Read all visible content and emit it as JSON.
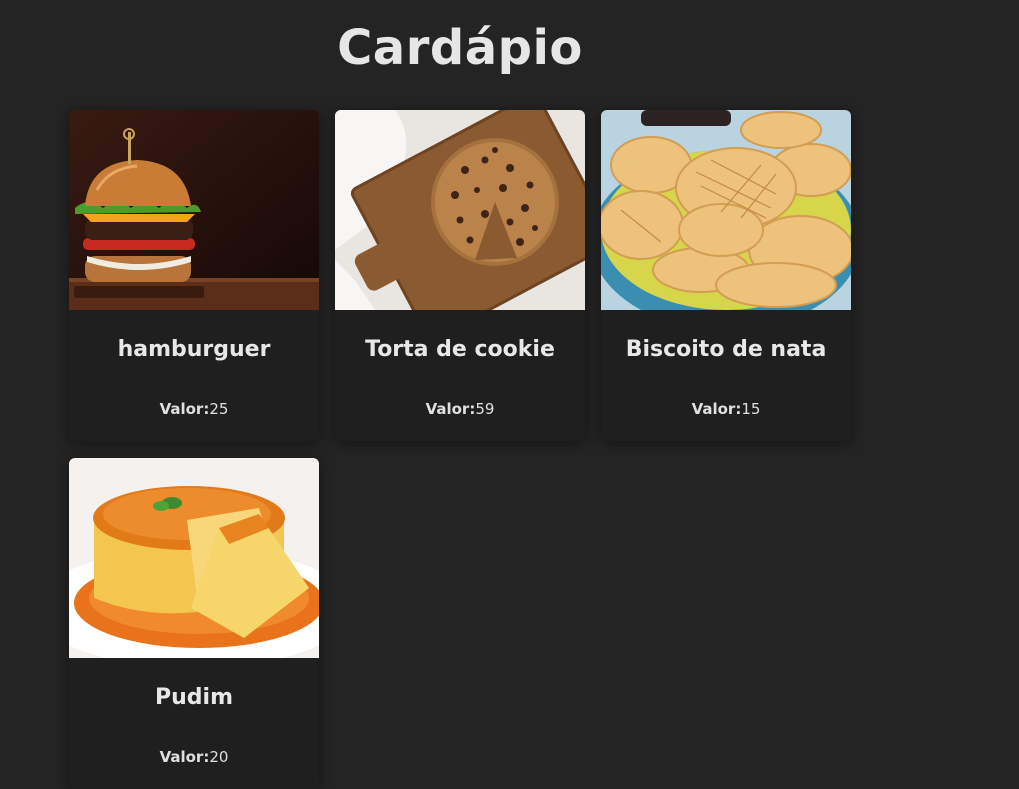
{
  "page": {
    "title": "Cardápio"
  },
  "menu": {
    "price_label": "Valor:",
    "items": [
      {
        "name": "hamburguer",
        "price": "25",
        "image": "hamburger-photo"
      },
      {
        "name": "Torta de cookie",
        "price": "59",
        "image": "cookie-pie-photo"
      },
      {
        "name": "Biscoito de nata",
        "price": "15",
        "image": "cream-biscuits-photo"
      },
      {
        "name": "Pudim",
        "price": "20",
        "image": "pudding-photo"
      }
    ]
  },
  "colors": {
    "background": "#242424",
    "card": "#1f1f1f",
    "text": "#e8e8e8"
  }
}
